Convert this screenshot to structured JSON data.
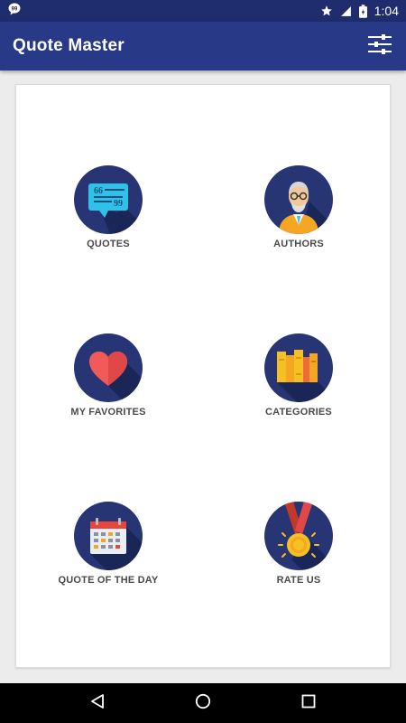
{
  "status_bar": {
    "time": "1:04",
    "icons": [
      "chat-notification-icon",
      "star-icon",
      "signal-icon",
      "battery-icon"
    ]
  },
  "app_bar": {
    "title": "Quote Master",
    "action_icon": "filter-settings-icon"
  },
  "colors": {
    "status_bar": "#1f2d6e",
    "app_bar": "#283a87",
    "icon_circle": "#273574",
    "label_text": "#4a4a4a"
  },
  "menu": [
    {
      "label": "QUOTES",
      "icon": "speech-bubble-icon"
    },
    {
      "label": "AUTHORS",
      "icon": "author-portrait-icon"
    },
    {
      "label": "MY FAVORITES",
      "icon": "heart-icon"
    },
    {
      "label": "CATEGORIES",
      "icon": "books-icon"
    },
    {
      "label": "QUOTE OF THE DAY",
      "icon": "calendar-icon"
    },
    {
      "label": "RATE US",
      "icon": "medal-icon"
    }
  ],
  "nav_bar": {
    "icons": [
      "back-icon",
      "home-icon",
      "recents-icon"
    ]
  }
}
